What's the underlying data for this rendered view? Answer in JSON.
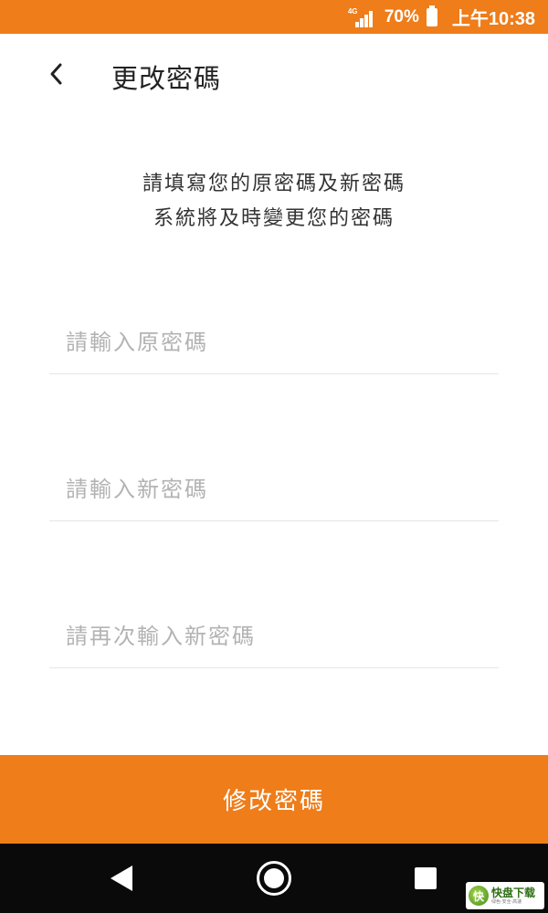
{
  "status_bar": {
    "network": "4G",
    "battery": "70%",
    "time": "上午10:38"
  },
  "header": {
    "back_icon": "chevron-left-icon",
    "title": "更改密碼"
  },
  "instruction": {
    "line1": "請填寫您的原密碼及新密碼",
    "line2": "系統將及時變更您的密碼"
  },
  "form": {
    "old_password_placeholder": "請輸入原密碼",
    "new_password_placeholder": "請輸入新密碼",
    "confirm_password_placeholder": "請再次輸入新密碼",
    "submit_label": "修改密碼"
  },
  "nav_bar": {
    "back_icon": "triangle-back-icon",
    "home_icon": "circle-home-icon",
    "recent_icon": "square-recents-icon"
  },
  "watermark": {
    "mark": "快",
    "main": "快盘下载",
    "sub": "绿色·安全·高速"
  },
  "colors": {
    "accent": "#ee7d1a",
    "nav_bar": "#0a0a0a",
    "placeholder": "#b3b3b3",
    "divider": "#e6e6e6"
  }
}
